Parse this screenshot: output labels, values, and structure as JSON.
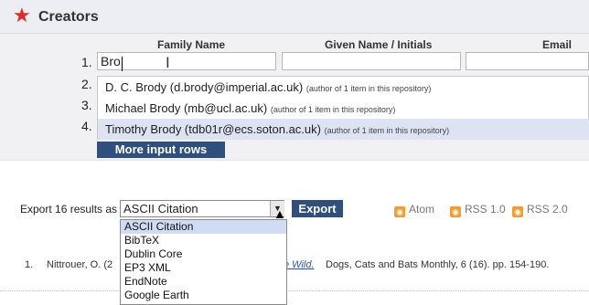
{
  "creators": {
    "title": "Creators",
    "columns": {
      "family": "Family Name",
      "given": "Given Name / Initials",
      "email": "Email"
    },
    "rows": [
      {
        "num": "1.",
        "family_value": "Bro"
      },
      {
        "num": "2."
      },
      {
        "num": "3."
      },
      {
        "num": "4."
      }
    ],
    "more_button": "More input rows"
  },
  "autocomplete": {
    "items": [
      {
        "name": "D. C. Brody (d.brody@imperial.ac.uk)",
        "note": "(author of 1 item in this repository)"
      },
      {
        "name": "Michael Brody (mb@ucl.ac.uk)",
        "note": "(author of 1 item in this repository)"
      },
      {
        "name": "Timothy Brody (tdb01r@ecs.soton.ac.uk)",
        "note": "(author of 1 item in this repository)"
      }
    ]
  },
  "export": {
    "label": "Export 16 results as",
    "selected": "ASCII Citation",
    "button": "Export",
    "feeds": {
      "atom": "Atom",
      "rss1": "RSS 1.0",
      "rss2": "RSS 2.0"
    },
    "options": [
      "ASCII Citation",
      "BibTeX",
      "Dublin Core",
      "EP3 XML",
      "EndNote",
      "Google Earth"
    ]
  },
  "result": {
    "num": "1.",
    "prefix": "Nittrouer, O. (2",
    "link": "e Wild.",
    "suffix": "Dogs, Cats and Bats Monthly, 6 (16). pp. 154-190."
  },
  "colors": {
    "accent": "#2f4f7f",
    "star": "#e02b2b",
    "selection": "#dde3f3"
  }
}
